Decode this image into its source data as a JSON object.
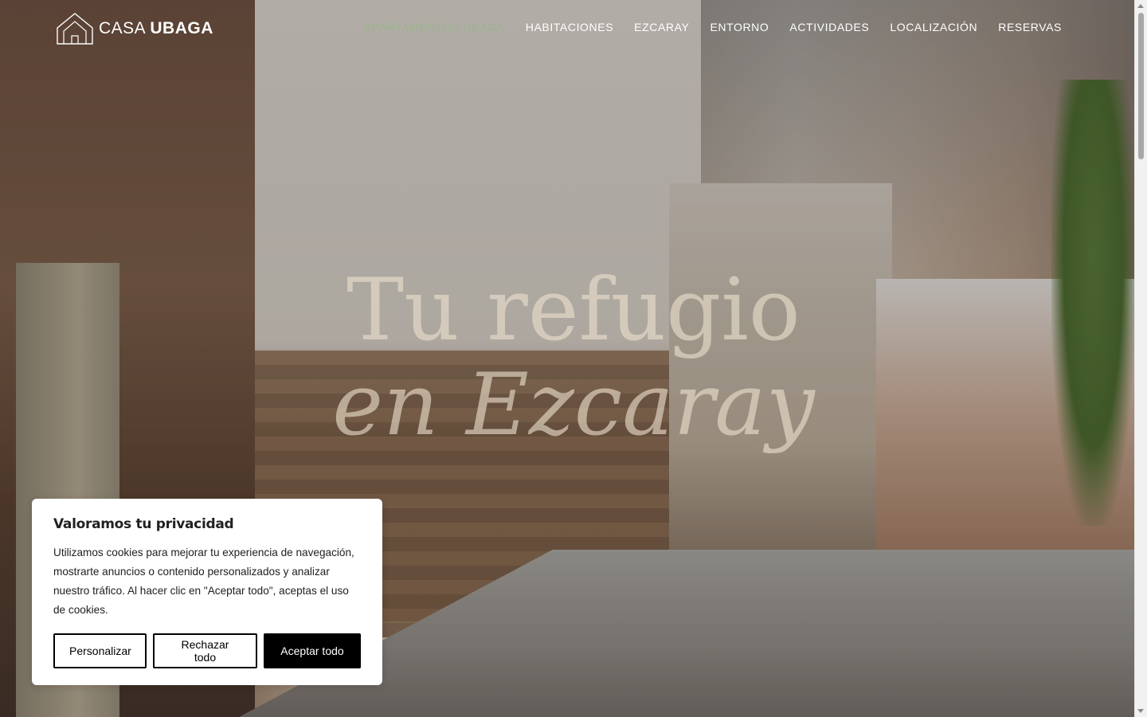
{
  "brand": {
    "prefix": "CASA",
    "name": "UBAGA"
  },
  "nav": {
    "items": [
      {
        "label": "APARTAMENTOS UBAGA",
        "active": true
      },
      {
        "label": "HABITACIONES",
        "active": false
      },
      {
        "label": "EZCARAY",
        "active": false
      },
      {
        "label": "ENTORNO",
        "active": false
      },
      {
        "label": "ACTIVIDADES",
        "active": false
      },
      {
        "label": "LOCALIZACIÓN",
        "active": false
      },
      {
        "label": "RESERVAS",
        "active": false
      }
    ],
    "active_color": "#9bb48a"
  },
  "hero": {
    "line1": "Tu refugio",
    "line2": "en Ezcaray"
  },
  "cookie_banner": {
    "title": "Valoramos tu privacidad",
    "text": "Utilizamos cookies para mejorar tu experiencia de navegación, mostrarte anuncios o contenido personalizados y analizar nuestro tráfico. Al hacer clic en \"Aceptar todo\", aceptas el uso de cookies.",
    "buttons": {
      "customize": "Personalizar",
      "reject": "Rechazar todo",
      "accept": "Aceptar todo"
    }
  }
}
